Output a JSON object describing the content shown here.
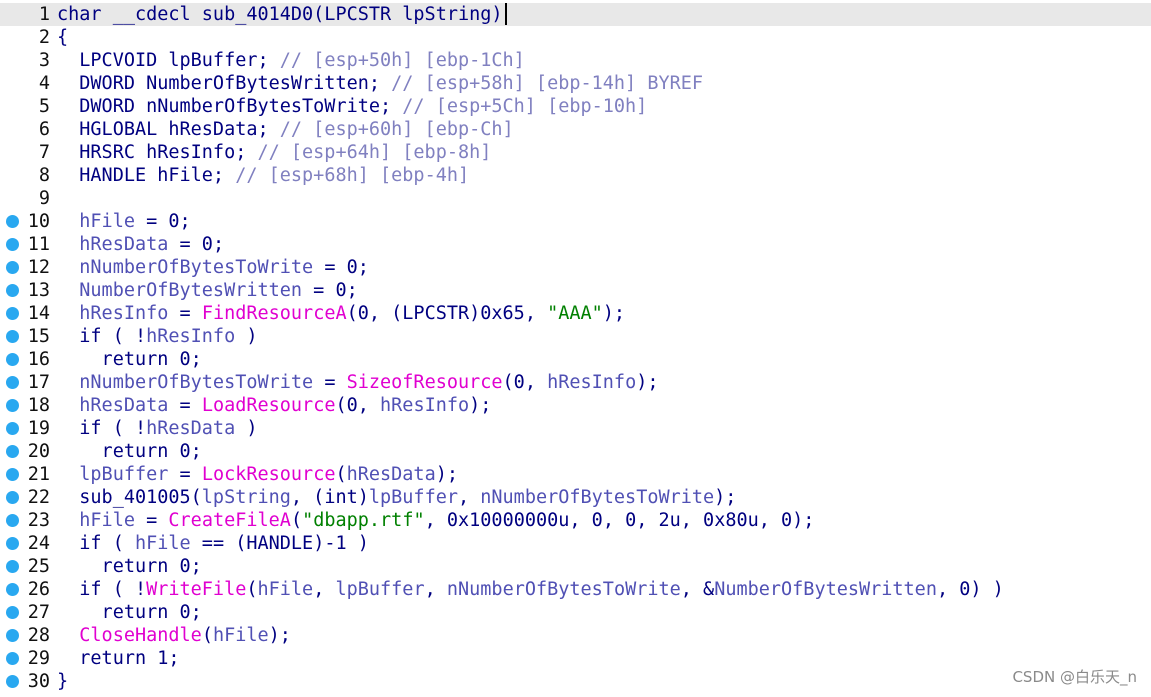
{
  "lines": [
    {
      "num": "1",
      "breakpoint": false,
      "current": true,
      "tokens": [
        {
          "t": "char __cdecl sub_4014D0(LPCSTR lpString)",
          "c": "kw"
        }
      ]
    },
    {
      "num": "2",
      "breakpoint": false,
      "tokens": [
        {
          "t": "{",
          "c": "kw"
        }
      ]
    },
    {
      "num": "3",
      "breakpoint": false,
      "tokens": [
        {
          "t": "  LPCVOID lpBuffer; ",
          "c": "kw"
        },
        {
          "t": "// [esp+50h] [ebp-1Ch]",
          "c": "cmt"
        }
      ]
    },
    {
      "num": "4",
      "breakpoint": false,
      "tokens": [
        {
          "t": "  DWORD NumberOfBytesWritten; ",
          "c": "kw"
        },
        {
          "t": "// [esp+58h] [ebp-14h] BYREF",
          "c": "cmt"
        }
      ]
    },
    {
      "num": "5",
      "breakpoint": false,
      "tokens": [
        {
          "t": "  DWORD nNumberOfBytesToWrite; ",
          "c": "kw"
        },
        {
          "t": "// [esp+5Ch] [ebp-10h]",
          "c": "cmt"
        }
      ]
    },
    {
      "num": "6",
      "breakpoint": false,
      "tokens": [
        {
          "t": "  HGLOBAL hResData; ",
          "c": "kw"
        },
        {
          "t": "// [esp+60h] [ebp-Ch]",
          "c": "cmt"
        }
      ]
    },
    {
      "num": "7",
      "breakpoint": false,
      "tokens": [
        {
          "t": "  HRSRC hResInfo; ",
          "c": "kw"
        },
        {
          "t": "// [esp+64h] [ebp-8h]",
          "c": "cmt"
        }
      ]
    },
    {
      "num": "8",
      "breakpoint": false,
      "tokens": [
        {
          "t": "  HANDLE hFile; ",
          "c": "kw"
        },
        {
          "t": "// [esp+68h] [ebp-4h]",
          "c": "cmt"
        }
      ]
    },
    {
      "num": "9",
      "breakpoint": false,
      "tokens": []
    },
    {
      "num": "10",
      "breakpoint": true,
      "tokens": [
        {
          "t": "  ",
          "c": "kw"
        },
        {
          "t": "hFile",
          "c": "var"
        },
        {
          "t": " = 0;",
          "c": "kw"
        }
      ]
    },
    {
      "num": "11",
      "breakpoint": true,
      "tokens": [
        {
          "t": "  ",
          "c": "kw"
        },
        {
          "t": "hResData",
          "c": "var"
        },
        {
          "t": " = 0;",
          "c": "kw"
        }
      ]
    },
    {
      "num": "12",
      "breakpoint": true,
      "tokens": [
        {
          "t": "  ",
          "c": "kw"
        },
        {
          "t": "nNumberOfBytesToWrite",
          "c": "var"
        },
        {
          "t": " = 0;",
          "c": "kw"
        }
      ]
    },
    {
      "num": "13",
      "breakpoint": true,
      "tokens": [
        {
          "t": "  ",
          "c": "kw"
        },
        {
          "t": "NumberOfBytesWritten",
          "c": "var"
        },
        {
          "t": " = 0;",
          "c": "kw"
        }
      ]
    },
    {
      "num": "14",
      "breakpoint": true,
      "tokens": [
        {
          "t": "  ",
          "c": "kw"
        },
        {
          "t": "hResInfo",
          "c": "var"
        },
        {
          "t": " = ",
          "c": "kw"
        },
        {
          "t": "FindResourceA",
          "c": "fn"
        },
        {
          "t": "(0, (LPCSTR)0x65, ",
          "c": "kw"
        },
        {
          "t": "\"AAA\"",
          "c": "str"
        },
        {
          "t": ");",
          "c": "kw"
        }
      ]
    },
    {
      "num": "15",
      "breakpoint": true,
      "tokens": [
        {
          "t": "  if ( !",
          "c": "kw"
        },
        {
          "t": "hResInfo",
          "c": "var"
        },
        {
          "t": " )",
          "c": "kw"
        }
      ]
    },
    {
      "num": "16",
      "breakpoint": true,
      "tokens": [
        {
          "t": "    return 0;",
          "c": "kw"
        }
      ]
    },
    {
      "num": "17",
      "breakpoint": true,
      "tokens": [
        {
          "t": "  ",
          "c": "kw"
        },
        {
          "t": "nNumberOfBytesToWrite",
          "c": "var"
        },
        {
          "t": " = ",
          "c": "kw"
        },
        {
          "t": "SizeofResource",
          "c": "fn"
        },
        {
          "t": "(0, ",
          "c": "kw"
        },
        {
          "t": "hResInfo",
          "c": "var"
        },
        {
          "t": ");",
          "c": "kw"
        }
      ]
    },
    {
      "num": "18",
      "breakpoint": true,
      "tokens": [
        {
          "t": "  ",
          "c": "kw"
        },
        {
          "t": "hResData",
          "c": "var"
        },
        {
          "t": " = ",
          "c": "kw"
        },
        {
          "t": "LoadResource",
          "c": "fn"
        },
        {
          "t": "(0, ",
          "c": "kw"
        },
        {
          "t": "hResInfo",
          "c": "var"
        },
        {
          "t": ");",
          "c": "kw"
        }
      ]
    },
    {
      "num": "19",
      "breakpoint": true,
      "tokens": [
        {
          "t": "  if ( !",
          "c": "kw"
        },
        {
          "t": "hResData",
          "c": "var"
        },
        {
          "t": " )",
          "c": "kw"
        }
      ]
    },
    {
      "num": "20",
      "breakpoint": true,
      "tokens": [
        {
          "t": "    return 0;",
          "c": "kw"
        }
      ]
    },
    {
      "num": "21",
      "breakpoint": true,
      "tokens": [
        {
          "t": "  ",
          "c": "kw"
        },
        {
          "t": "lpBuffer",
          "c": "var"
        },
        {
          "t": " = ",
          "c": "kw"
        },
        {
          "t": "LockResource",
          "c": "fn"
        },
        {
          "t": "(",
          "c": "kw"
        },
        {
          "t": "hResData",
          "c": "var"
        },
        {
          "t": ");",
          "c": "kw"
        }
      ]
    },
    {
      "num": "22",
      "breakpoint": true,
      "tokens": [
        {
          "t": "  sub_401005(",
          "c": "kw"
        },
        {
          "t": "lpString",
          "c": "var"
        },
        {
          "t": ", (int)",
          "c": "kw"
        },
        {
          "t": "lpBuffer",
          "c": "var"
        },
        {
          "t": ", ",
          "c": "kw"
        },
        {
          "t": "nNumberOfBytesToWrite",
          "c": "var"
        },
        {
          "t": ");",
          "c": "kw"
        }
      ]
    },
    {
      "num": "23",
      "breakpoint": true,
      "tokens": [
        {
          "t": "  ",
          "c": "kw"
        },
        {
          "t": "hFile",
          "c": "var"
        },
        {
          "t": " = ",
          "c": "kw"
        },
        {
          "t": "CreateFileA",
          "c": "fn"
        },
        {
          "t": "(",
          "c": "kw"
        },
        {
          "t": "\"dbapp.rtf\"",
          "c": "str"
        },
        {
          "t": ", 0x10000000u, 0, 0, 2u, 0x80u, 0);",
          "c": "kw"
        }
      ]
    },
    {
      "num": "24",
      "breakpoint": true,
      "tokens": [
        {
          "t": "  if ( ",
          "c": "kw"
        },
        {
          "t": "hFile",
          "c": "var"
        },
        {
          "t": " == (HANDLE)-1 )",
          "c": "kw"
        }
      ]
    },
    {
      "num": "25",
      "breakpoint": true,
      "tokens": [
        {
          "t": "    return 0;",
          "c": "kw"
        }
      ]
    },
    {
      "num": "26",
      "breakpoint": true,
      "tokens": [
        {
          "t": "  if ( !",
          "c": "kw"
        },
        {
          "t": "WriteFile",
          "c": "fn"
        },
        {
          "t": "(",
          "c": "kw"
        },
        {
          "t": "hFile",
          "c": "var"
        },
        {
          "t": ", ",
          "c": "kw"
        },
        {
          "t": "lpBuffer",
          "c": "var"
        },
        {
          "t": ", ",
          "c": "kw"
        },
        {
          "t": "nNumberOfBytesToWrite",
          "c": "var"
        },
        {
          "t": ", &",
          "c": "kw"
        },
        {
          "t": "NumberOfBytesWritten",
          "c": "var"
        },
        {
          "t": ", 0) )",
          "c": "kw"
        }
      ]
    },
    {
      "num": "27",
      "breakpoint": true,
      "tokens": [
        {
          "t": "    return 0;",
          "c": "kw"
        }
      ]
    },
    {
      "num": "28",
      "breakpoint": true,
      "tokens": [
        {
          "t": "  ",
          "c": "kw"
        },
        {
          "t": "CloseHandle",
          "c": "fn"
        },
        {
          "t": "(",
          "c": "kw"
        },
        {
          "t": "hFile",
          "c": "var"
        },
        {
          "t": ");",
          "c": "kw"
        }
      ]
    },
    {
      "num": "29",
      "breakpoint": true,
      "tokens": [
        {
          "t": "  return 1;",
          "c": "kw"
        }
      ]
    },
    {
      "num": "30",
      "breakpoint": true,
      "tokens": [
        {
          "t": "}",
          "c": "kw"
        }
      ]
    }
  ],
  "watermark": "CSDN @白乐天_n",
  "colors": {
    "keyword": "#000080",
    "variable": "#5050b4",
    "comment": "#8080c0",
    "function": "#e000d0",
    "string": "#008000",
    "breakpoint": "#29a8f0",
    "current_line": "#e8e8e8"
  }
}
